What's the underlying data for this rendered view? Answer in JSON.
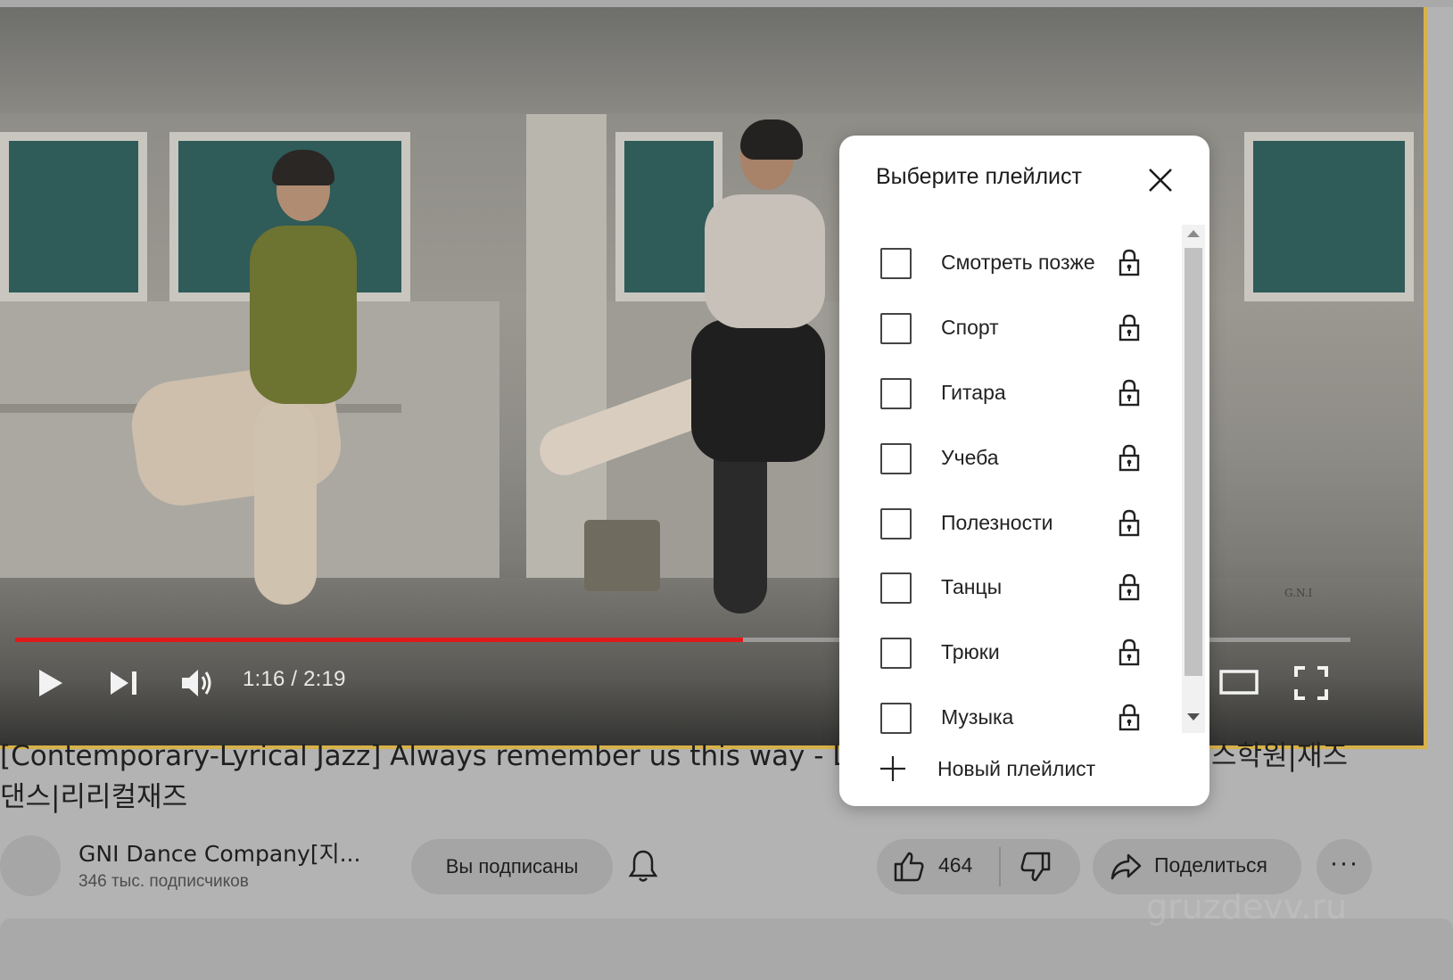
{
  "player": {
    "time": "1:16 / 2:19",
    "progress_fraction": 0.545,
    "watermark": "G.N.I"
  },
  "video": {
    "title_line1": "[Contemporary-Lyrical Jazz] Always remember us this way - Lady",
    "title_line1_tail": "스학원|재즈",
    "title_line2": "댄스|리리컬재즈"
  },
  "channel": {
    "name": "GNI Dance Company[지...",
    "subscribers": "346 тыс. подписчиков",
    "subscribed_label": "Вы подписаны"
  },
  "actions": {
    "like_count": "464",
    "share_label": "Поделиться",
    "more_label": "···"
  },
  "dialog": {
    "title": "Выберите плейлист",
    "playlists": [
      {
        "label": "Смотреть позже",
        "checked": false,
        "private": true
      },
      {
        "label": "Спорт",
        "checked": false,
        "private": true
      },
      {
        "label": "Гитара",
        "checked": false,
        "private": true
      },
      {
        "label": "Учеба",
        "checked": false,
        "private": true
      },
      {
        "label": "Полезности",
        "checked": false,
        "private": true
      },
      {
        "label": "Танцы",
        "checked": false,
        "private": true
      },
      {
        "label": "Трюки",
        "checked": false,
        "private": true
      },
      {
        "label": "Музыка",
        "checked": false,
        "private": true
      }
    ],
    "new_playlist_label": "Новый плейлист"
  },
  "site_watermark": "gruzdevv.ru",
  "colors": {
    "progress": "#e01a1a",
    "page_bg": "#b3b3b3",
    "dialog_bg": "#ffffff"
  },
  "icons": [
    "play-icon",
    "next-icon",
    "volume-icon",
    "theater-icon",
    "fullscreen-icon",
    "close-icon",
    "lock-icon",
    "plus-icon",
    "bell-icon",
    "like-icon",
    "dislike-icon",
    "share-icon",
    "more-icon"
  ]
}
